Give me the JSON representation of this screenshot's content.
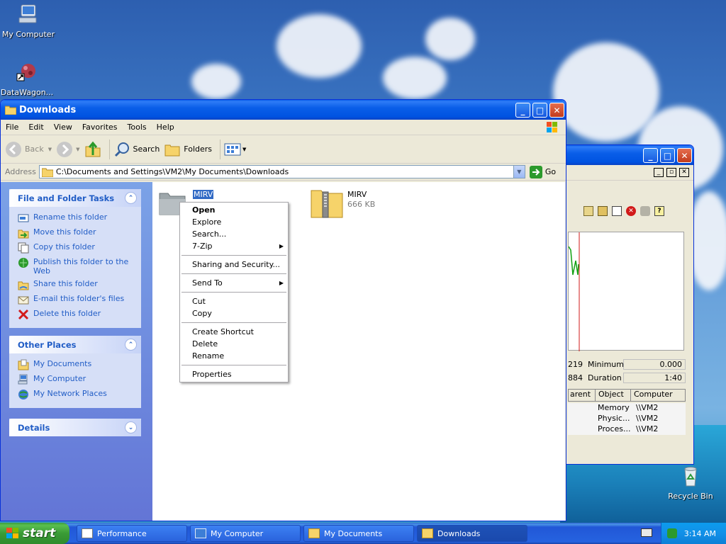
{
  "desktop": {
    "icons": [
      {
        "label": "My Computer",
        "icon": "my-computer-icon"
      },
      {
        "label": "DataWagon...",
        "icon": "datawagon-shortcut-icon"
      },
      {
        "label": "Recycle Bin",
        "icon": "recycle-bin-icon"
      }
    ]
  },
  "explorer": {
    "title": "Downloads",
    "menu": [
      "File",
      "Edit",
      "View",
      "Favorites",
      "Tools",
      "Help"
    ],
    "toolbar": {
      "back": "Back",
      "search": "Search",
      "folders": "Folders"
    },
    "address": {
      "label": "Address",
      "value": "C:\\Documents and Settings\\VM2\\My Documents\\Downloads",
      "go": "Go"
    },
    "tasks": {
      "file_folder": {
        "title": "File and Folder Tasks",
        "items": [
          "Rename this folder",
          "Move this folder",
          "Copy this folder",
          "Publish this folder to the Web",
          "Share this folder",
          "E-mail this folder's files",
          "Delete this folder"
        ]
      },
      "other_places": {
        "title": "Other Places",
        "items": [
          "My Documents",
          "My Computer",
          "My Network Places"
        ]
      },
      "details": {
        "title": "Details"
      }
    },
    "files": [
      {
        "name": "MIRV",
        "type": "folder",
        "selected": true
      },
      {
        "name": "MIRV",
        "type": "zip",
        "size": "666 KB"
      }
    ],
    "context_menu": {
      "groups": [
        [
          "Open",
          "Explore",
          "Search...",
          "7-Zip"
        ],
        [
          "Sharing and Security..."
        ],
        [
          "Send To"
        ],
        [
          "Cut",
          "Copy"
        ],
        [
          "Create Shortcut",
          "Delete",
          "Rename"
        ],
        [
          "Properties"
        ]
      ],
      "submenu_items": [
        "7-Zip",
        "Send To"
      ],
      "bold_item": "Open"
    }
  },
  "perf_window": {
    "stats": [
      {
        "left": "219",
        "label": "Minimum",
        "value": "0.000"
      },
      {
        "left": "884",
        "label": "Duration",
        "value": "1:40"
      }
    ],
    "columns": [
      "arent",
      "Object",
      "Computer"
    ],
    "rows": [
      {
        "object": "Memory",
        "computer": "\\\\VM2"
      },
      {
        "object": "Physic...",
        "computer": "\\\\VM2"
      },
      {
        "object": "Proces...",
        "computer": "\\\\VM2"
      }
    ]
  },
  "taskbar": {
    "start": "start",
    "tasks": [
      "Performance",
      "My Computer",
      "My Documents",
      "Downloads"
    ],
    "active_task": "Downloads",
    "clock": "3:14 AM"
  },
  "colors": {
    "xp_blue": "#0053e1",
    "task_link": "#215dc6",
    "start_green": "#3a9b36"
  }
}
